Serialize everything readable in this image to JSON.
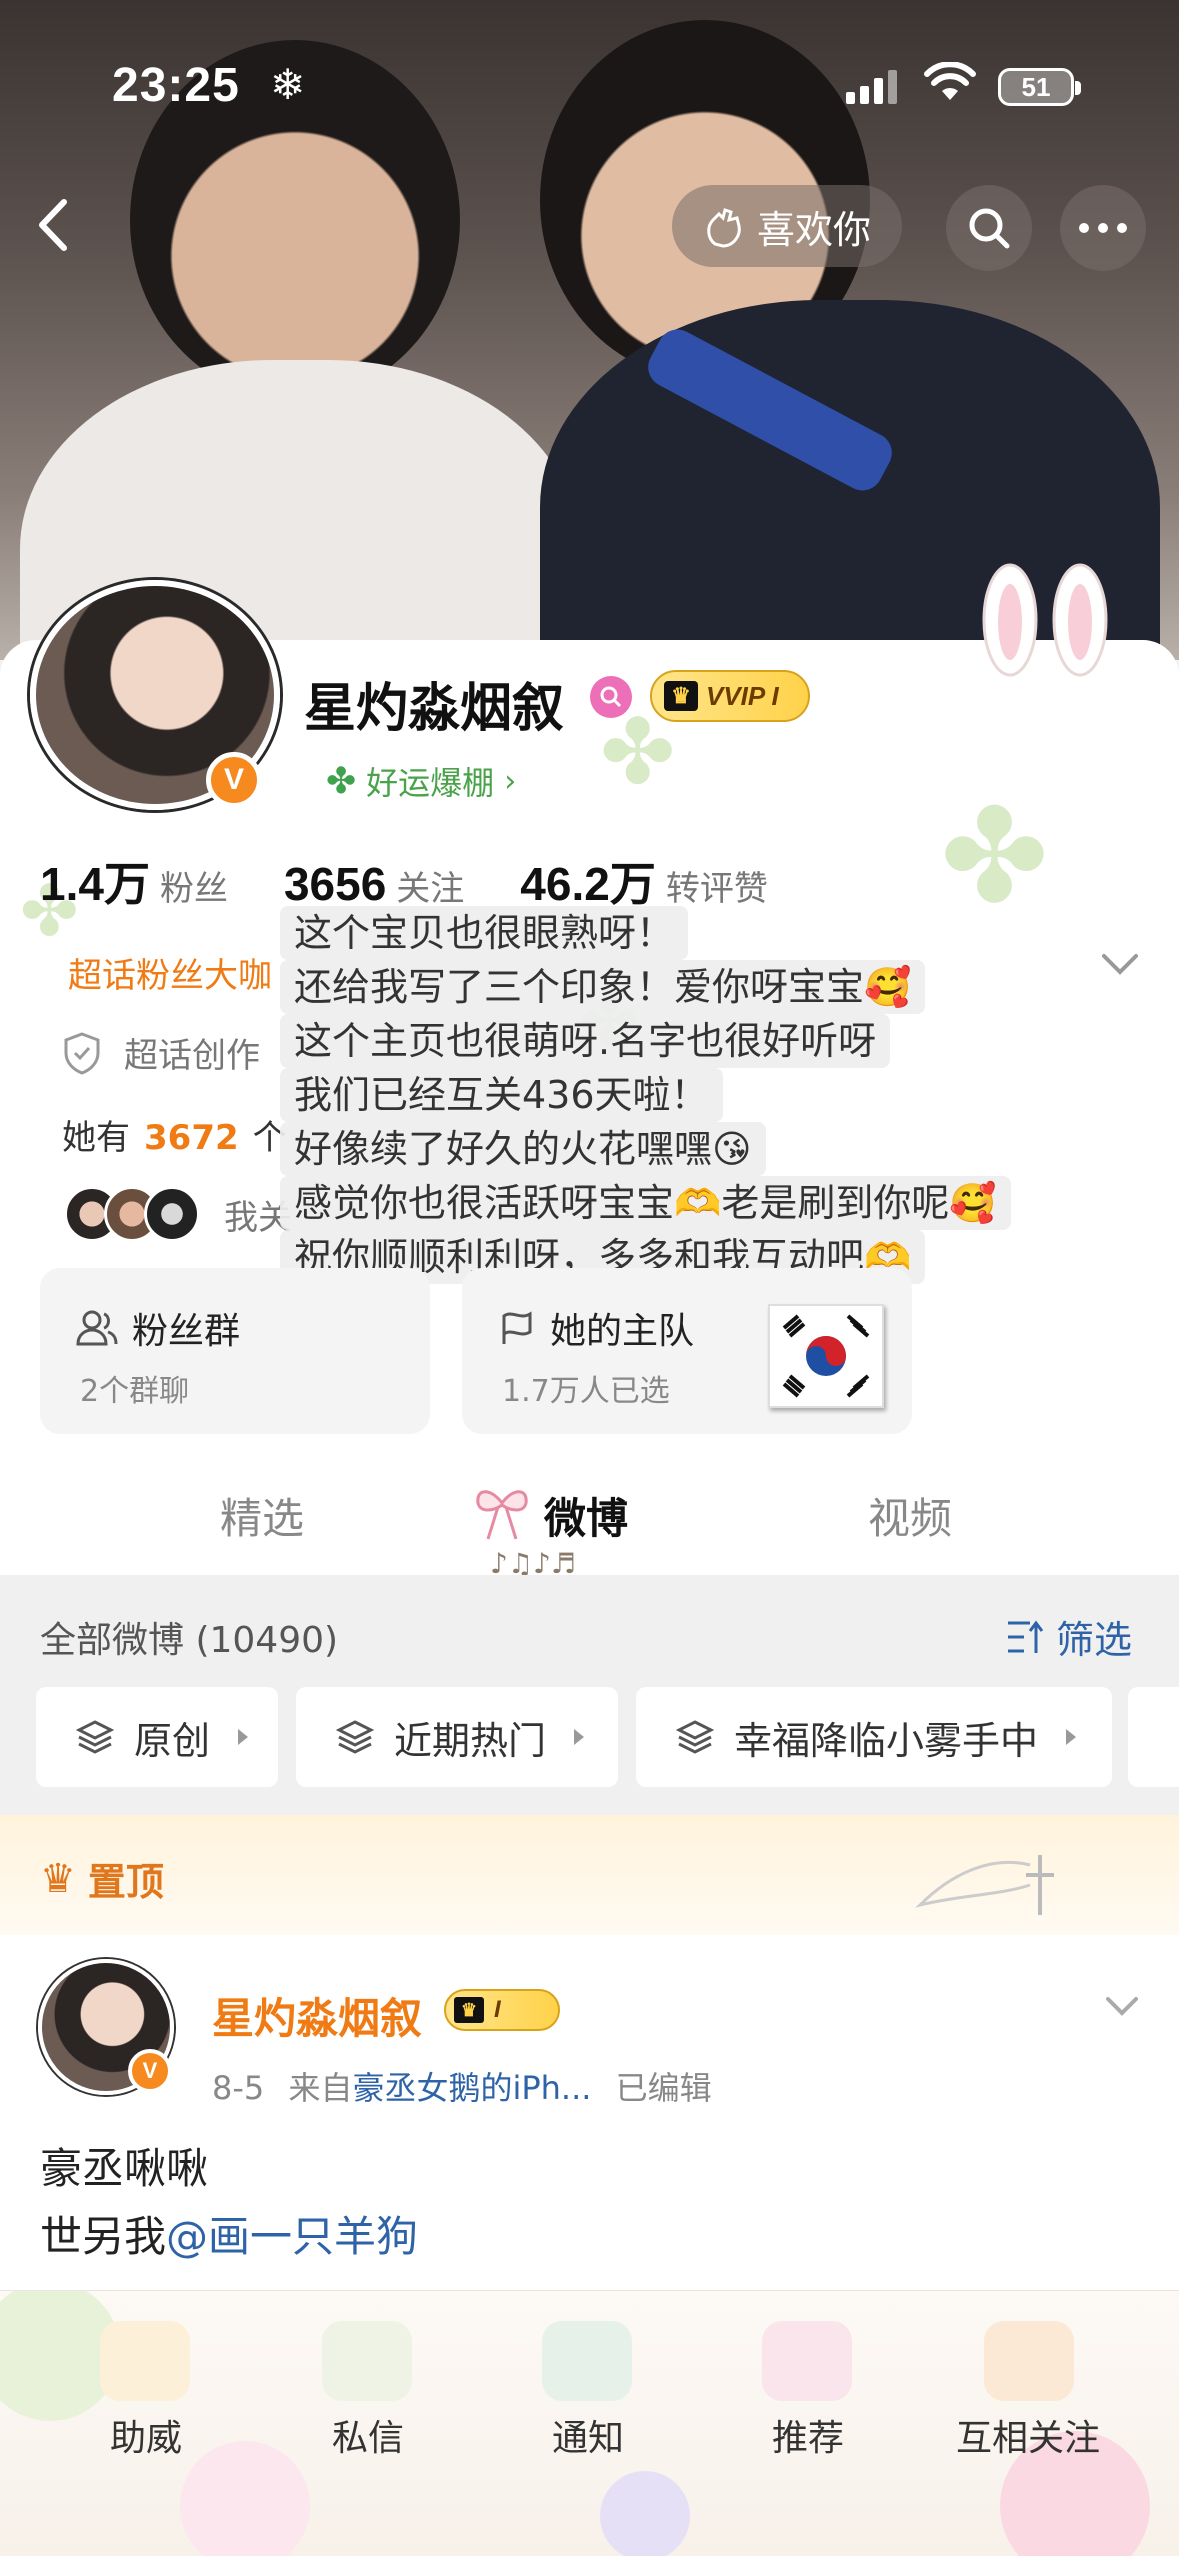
{
  "status_bar": {
    "time": "23:25",
    "weather_icon": "snowflake-icon",
    "battery": "51"
  },
  "nav": {
    "like_label": "喜欢你"
  },
  "profile": {
    "name": "星灼淼烟叙",
    "vip_label": "VVIP I",
    "luck_label": "好运爆棚",
    "stats": [
      {
        "value": "1.4万",
        "label": "粉丝"
      },
      {
        "value": "3656",
        "label": "关注"
      },
      {
        "value": "46.2万",
        "label": "转评赞"
      }
    ],
    "fan_link": "超话粉丝大咖",
    "creator_label": "超话创作",
    "she_has_prefix": "她有",
    "she_has_count": "3672",
    "she_has_suffix": "个",
    "follow_text": "我关"
  },
  "comment_lines": [
    "这个宝贝也很眼熟呀！",
    "还给我写了三个印象！爱你呀宝宝🥰",
    "这个主页也很萌呀.名字也很好听呀",
    "我们已经互关436天啦！",
    "好像续了好久的火花嘿嘿😘",
    "感觉你也很活跃呀宝宝🫶老是刷到你呢🥰",
    "祝你顺顺利利呀，多多和我互动吧🫶"
  ],
  "tiles": {
    "fans": {
      "title": "粉丝群",
      "sub": "2个群聊"
    },
    "team": {
      "title": "她的主队",
      "sub": "1.7万人已选"
    }
  },
  "tabs": [
    "精选",
    "微博",
    "视频"
  ],
  "list": {
    "all_label": "全部微博 (10490)",
    "filter_label": "筛选",
    "chips": [
      "原创",
      "近期热门",
      "幸福降临小雾手中"
    ]
  },
  "pinned_label": "置顶",
  "post": {
    "author": "星灼淼烟叙",
    "vip_label": "I",
    "date": "8-5",
    "from_prefix": "来自",
    "source": "豪丞女鹅的iPh...",
    "edited": "已编辑",
    "line1": "豪丞啾啾",
    "line2_prefix": "世另我",
    "mention": "@画一只羊狗"
  },
  "bottom_bar": [
    "助威",
    "私信",
    "通知",
    "推荐",
    "互相关注"
  ],
  "colors": {
    "accent_orange": "#f07b14",
    "link_blue": "#2e63a8",
    "luck_green": "#4aa34a"
  }
}
